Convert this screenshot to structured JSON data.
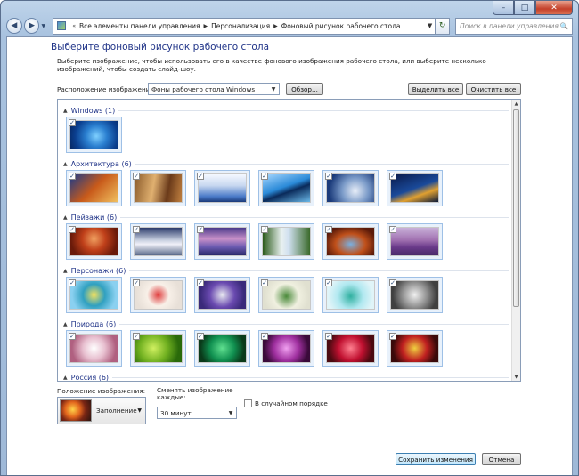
{
  "caption": {
    "min": "–",
    "max": "□",
    "close": "✕"
  },
  "nav": {
    "back": "◀",
    "forward": "▶",
    "dropdown": "▼",
    "breadcrumb": [
      "Все элементы панели управления",
      "Персонализация",
      "Фоновый рисунок рабочего стола"
    ],
    "refresh": "↻",
    "search_placeholder": "Поиск в панели управления",
    "search_icon": "🔍"
  },
  "heading": "Выберите фоновый рисунок рабочего стола",
  "description": "Выберите изображение, чтобы использовать его в качестве фонового изображения рабочего стола, или выберите несколько изображений, чтобы создать слайд-шоу.",
  "location": {
    "label": "Расположение изображения:",
    "value": "Фоны рабочего стола Windows",
    "browse": "Обзор...",
    "select_all": "Выделить все",
    "clear_all": "Очистить все"
  },
  "groups": [
    {
      "name": "Windows (1)",
      "tiles": [
        "windows-logo"
      ]
    },
    {
      "name": "Архитектура (6)",
      "tiles": [
        "arch1",
        "arch2",
        "arch3",
        "arch4",
        "arch5",
        "arch6"
      ]
    },
    {
      "name": "Пейзажи (6)",
      "tiles": [
        "land1",
        "land2",
        "land3",
        "land4",
        "land5",
        "land6"
      ]
    },
    {
      "name": "Персонажи (6)",
      "tiles": [
        "char1",
        "char2",
        "char3",
        "char4",
        "char5",
        "char6"
      ]
    },
    {
      "name": "Природа (6)",
      "tiles": [
        "nat1",
        "nat2",
        "nat3",
        "nat4",
        "nat5",
        "nat6"
      ]
    },
    {
      "name": "Россия (6)",
      "tiles": []
    }
  ],
  "position": {
    "label": "Положение изображения:",
    "value": "Заполнение"
  },
  "interval": {
    "label": "Сменять изображение каждые:",
    "value": "30 минут"
  },
  "shuffle": {
    "label": "В случайном порядке",
    "checked": false
  },
  "footer": {
    "save": "Сохранить изменения",
    "cancel": "Отмена"
  },
  "colors": {
    "heading": "#1e3287",
    "tile_border": "#9ec0e6"
  }
}
